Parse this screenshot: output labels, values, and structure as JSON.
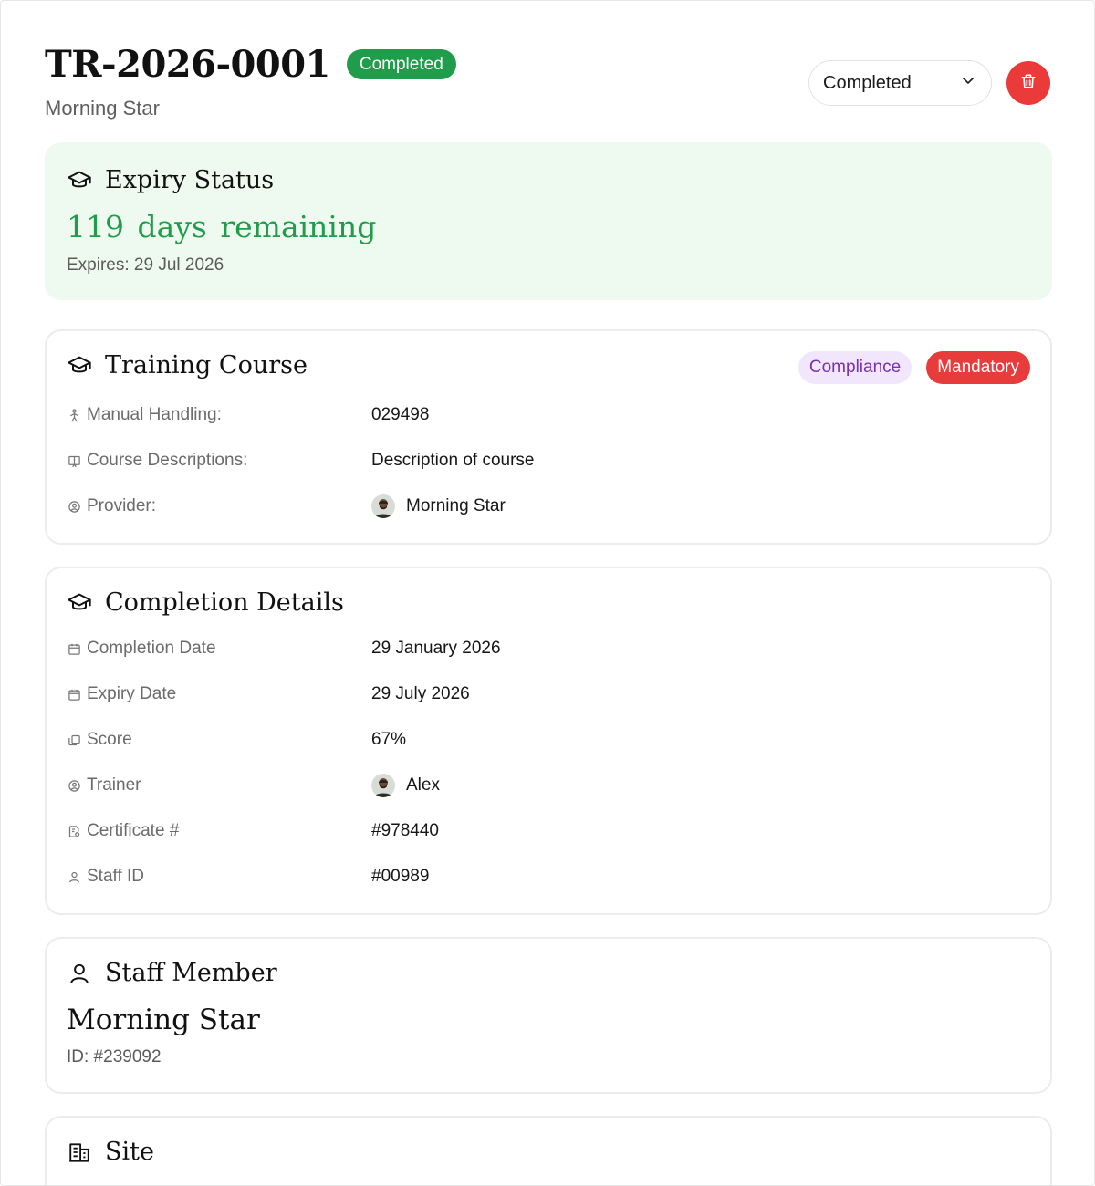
{
  "header": {
    "record_id": "TR-2026-0001",
    "status_badge": "Completed",
    "subtitle": "Morning Star",
    "status_select": {
      "value": "Completed",
      "icon": "chevron-down-icon"
    },
    "delete_icon": "trash-icon"
  },
  "expiry": {
    "title": "Expiry Status",
    "days_remaining": "119  days remaining",
    "expires": "Expires: 29 Jul 2026"
  },
  "training_course": {
    "title": "Training Course",
    "tags": [
      "Compliance",
      "Mandatory"
    ],
    "rows": [
      {
        "label": "Manual Handling:",
        "value": "029498",
        "icon": "person-lifting-icon"
      },
      {
        "label": "Course Descriptions:",
        "value": "Description of course",
        "icon": "book-icon"
      },
      {
        "label": "Provider:",
        "value": "Morning Star",
        "icon": "user-circle-icon",
        "avatar": true
      }
    ]
  },
  "completion": {
    "title": "Completion Details",
    "rows": [
      {
        "label": "Completion Date",
        "value": "29 January 2026",
        "icon": "calendar-icon"
      },
      {
        "label": "Expiry Date",
        "value": "29 July 2026",
        "icon": "calendar-icon"
      },
      {
        "label": "Score",
        "value": "67%",
        "icon": "copy-icon"
      },
      {
        "label": "Trainer",
        "value": "Alex",
        "icon": "user-circle-icon",
        "avatar": true
      },
      {
        "label": "Certificate #",
        "value": "#978440",
        "icon": "certificate-icon"
      },
      {
        "label": "Staff ID",
        "value": "#00989",
        "icon": "user-icon"
      }
    ]
  },
  "staff": {
    "title": "Staff Member",
    "name": "Morning Star",
    "id": "ID: #239092"
  },
  "site": {
    "title": "Site"
  },
  "colors": {
    "green": "#1f9d4a",
    "red": "#ea3a3a",
    "purple": "#7a2fb4",
    "expiry_bg": "#eef9f0"
  }
}
